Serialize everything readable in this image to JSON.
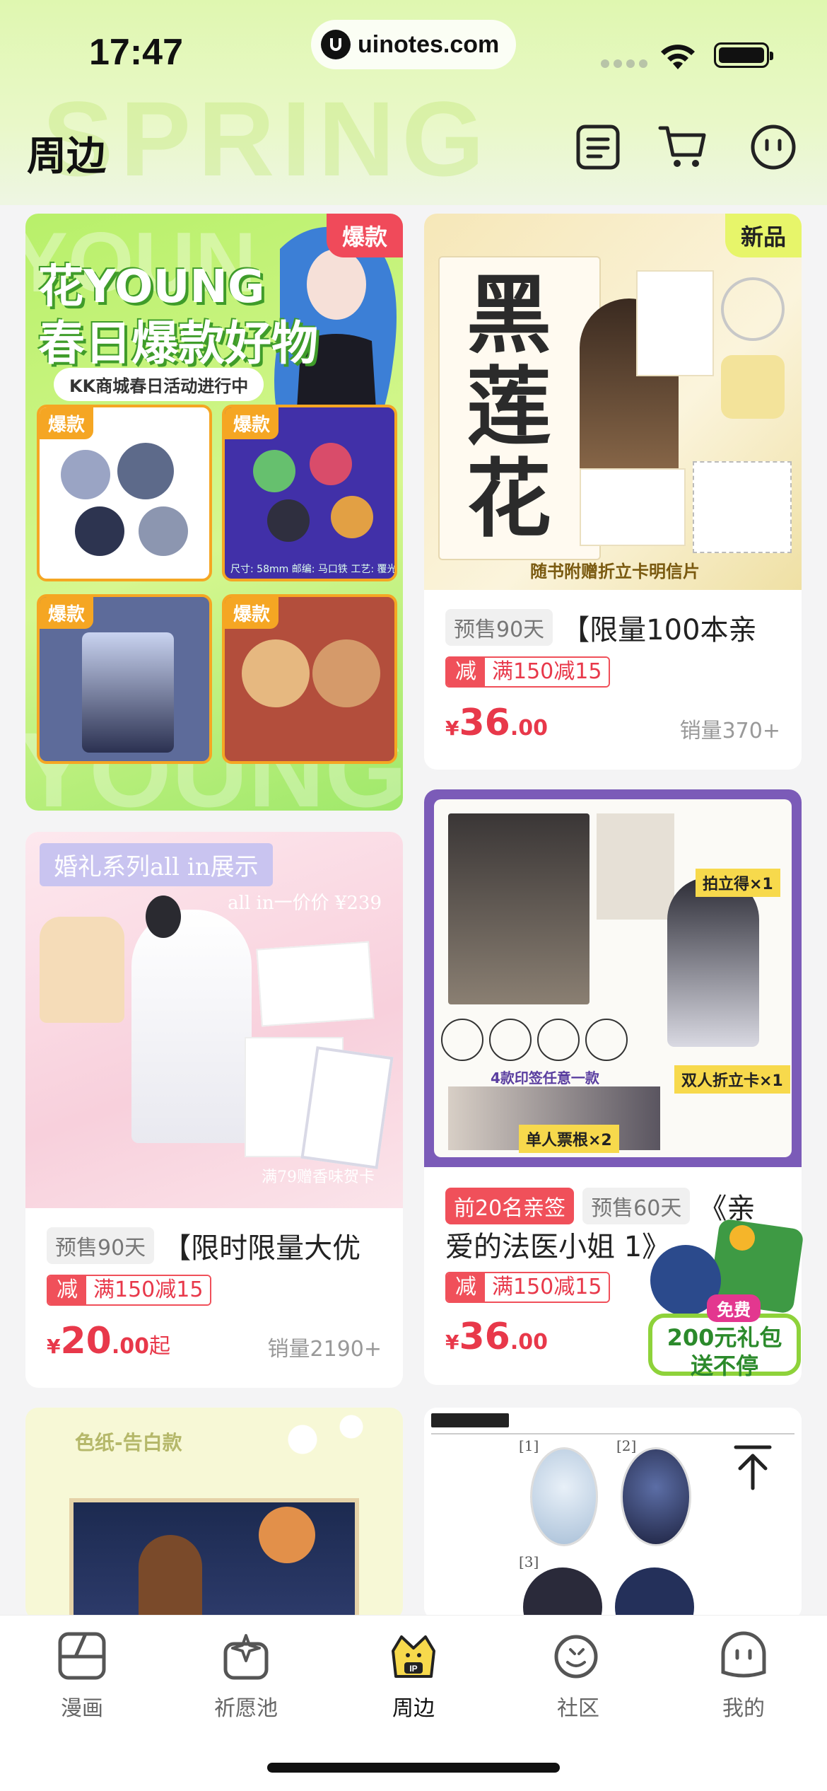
{
  "status_bar": {
    "time": "17:47",
    "url": "uinotes.com"
  },
  "header": {
    "title": "周边"
  },
  "products": [
    {
      "badge": "爆款",
      "banner": {
        "headline_1": "花YOUNG",
        "headline_2": "春日爆款好物",
        "subtitle": "KK商城春日活动进行中",
        "tile_label": "爆款",
        "footer_text": "尺寸: 58mm 邮编: 马口铁 工艺: 覆光"
      }
    },
    {
      "badge": "新品",
      "image_caption": "随书附赠折立卡明信片",
      "tags": [
        "预售90天"
      ],
      "title": "【限量100本亲",
      "promo_key": "减",
      "promo_value": "满150减15",
      "price_int": "36",
      "price_dec": ".00",
      "sales": "销量370+"
    },
    {
      "banner": {
        "headline": "婚礼系列all in展示",
        "price_note": "all in一价价 ¥239",
        "footer": "满79赠香味贺卡"
      },
      "tags": [
        "预售90天"
      ],
      "title": "【限时限量大优",
      "promo_key": "减",
      "promo_value": "满150减15",
      "price_int": "20",
      "price_dec": ".00",
      "price_suffix": "起",
      "sales": "销量2190+"
    },
    {
      "labels": [
        "拍立得×1",
        "双人折立卡×1",
        "4款印签任意一款",
        "单人票根×2"
      ],
      "tags_red": [
        "前20名亲签"
      ],
      "tags": [
        "预售60天"
      ],
      "title_line1": "《亲",
      "title_line2": "爱的法医小姐 1》",
      "promo_key": "减",
      "promo_value": "满150减15",
      "price_int": "36",
      "price_dec": ".00"
    },
    {
      "banner": {
        "headline": "色纸-告白款"
      }
    },
    {
      "banner": {
        "marks": [
          "[1]",
          "[2]",
          "[3]"
        ]
      }
    }
  ],
  "float_gift": {
    "line1": "免费",
    "line2": "200元礼包",
    "line3": "送不停"
  },
  "currency": "¥",
  "tabbar": [
    {
      "label": "漫画",
      "icon": "comic-icon"
    },
    {
      "label": "祈愿池",
      "icon": "wish-pool-icon"
    },
    {
      "label": "周边",
      "icon": "ip-merch-icon"
    },
    {
      "label": "社区",
      "icon": "community-icon"
    },
    {
      "label": "我的",
      "icon": "profile-icon"
    }
  ],
  "colors": {
    "accent_red": "#e8384a",
    "header_green": "#dff7b0",
    "badge_new": "#e7f56a"
  }
}
